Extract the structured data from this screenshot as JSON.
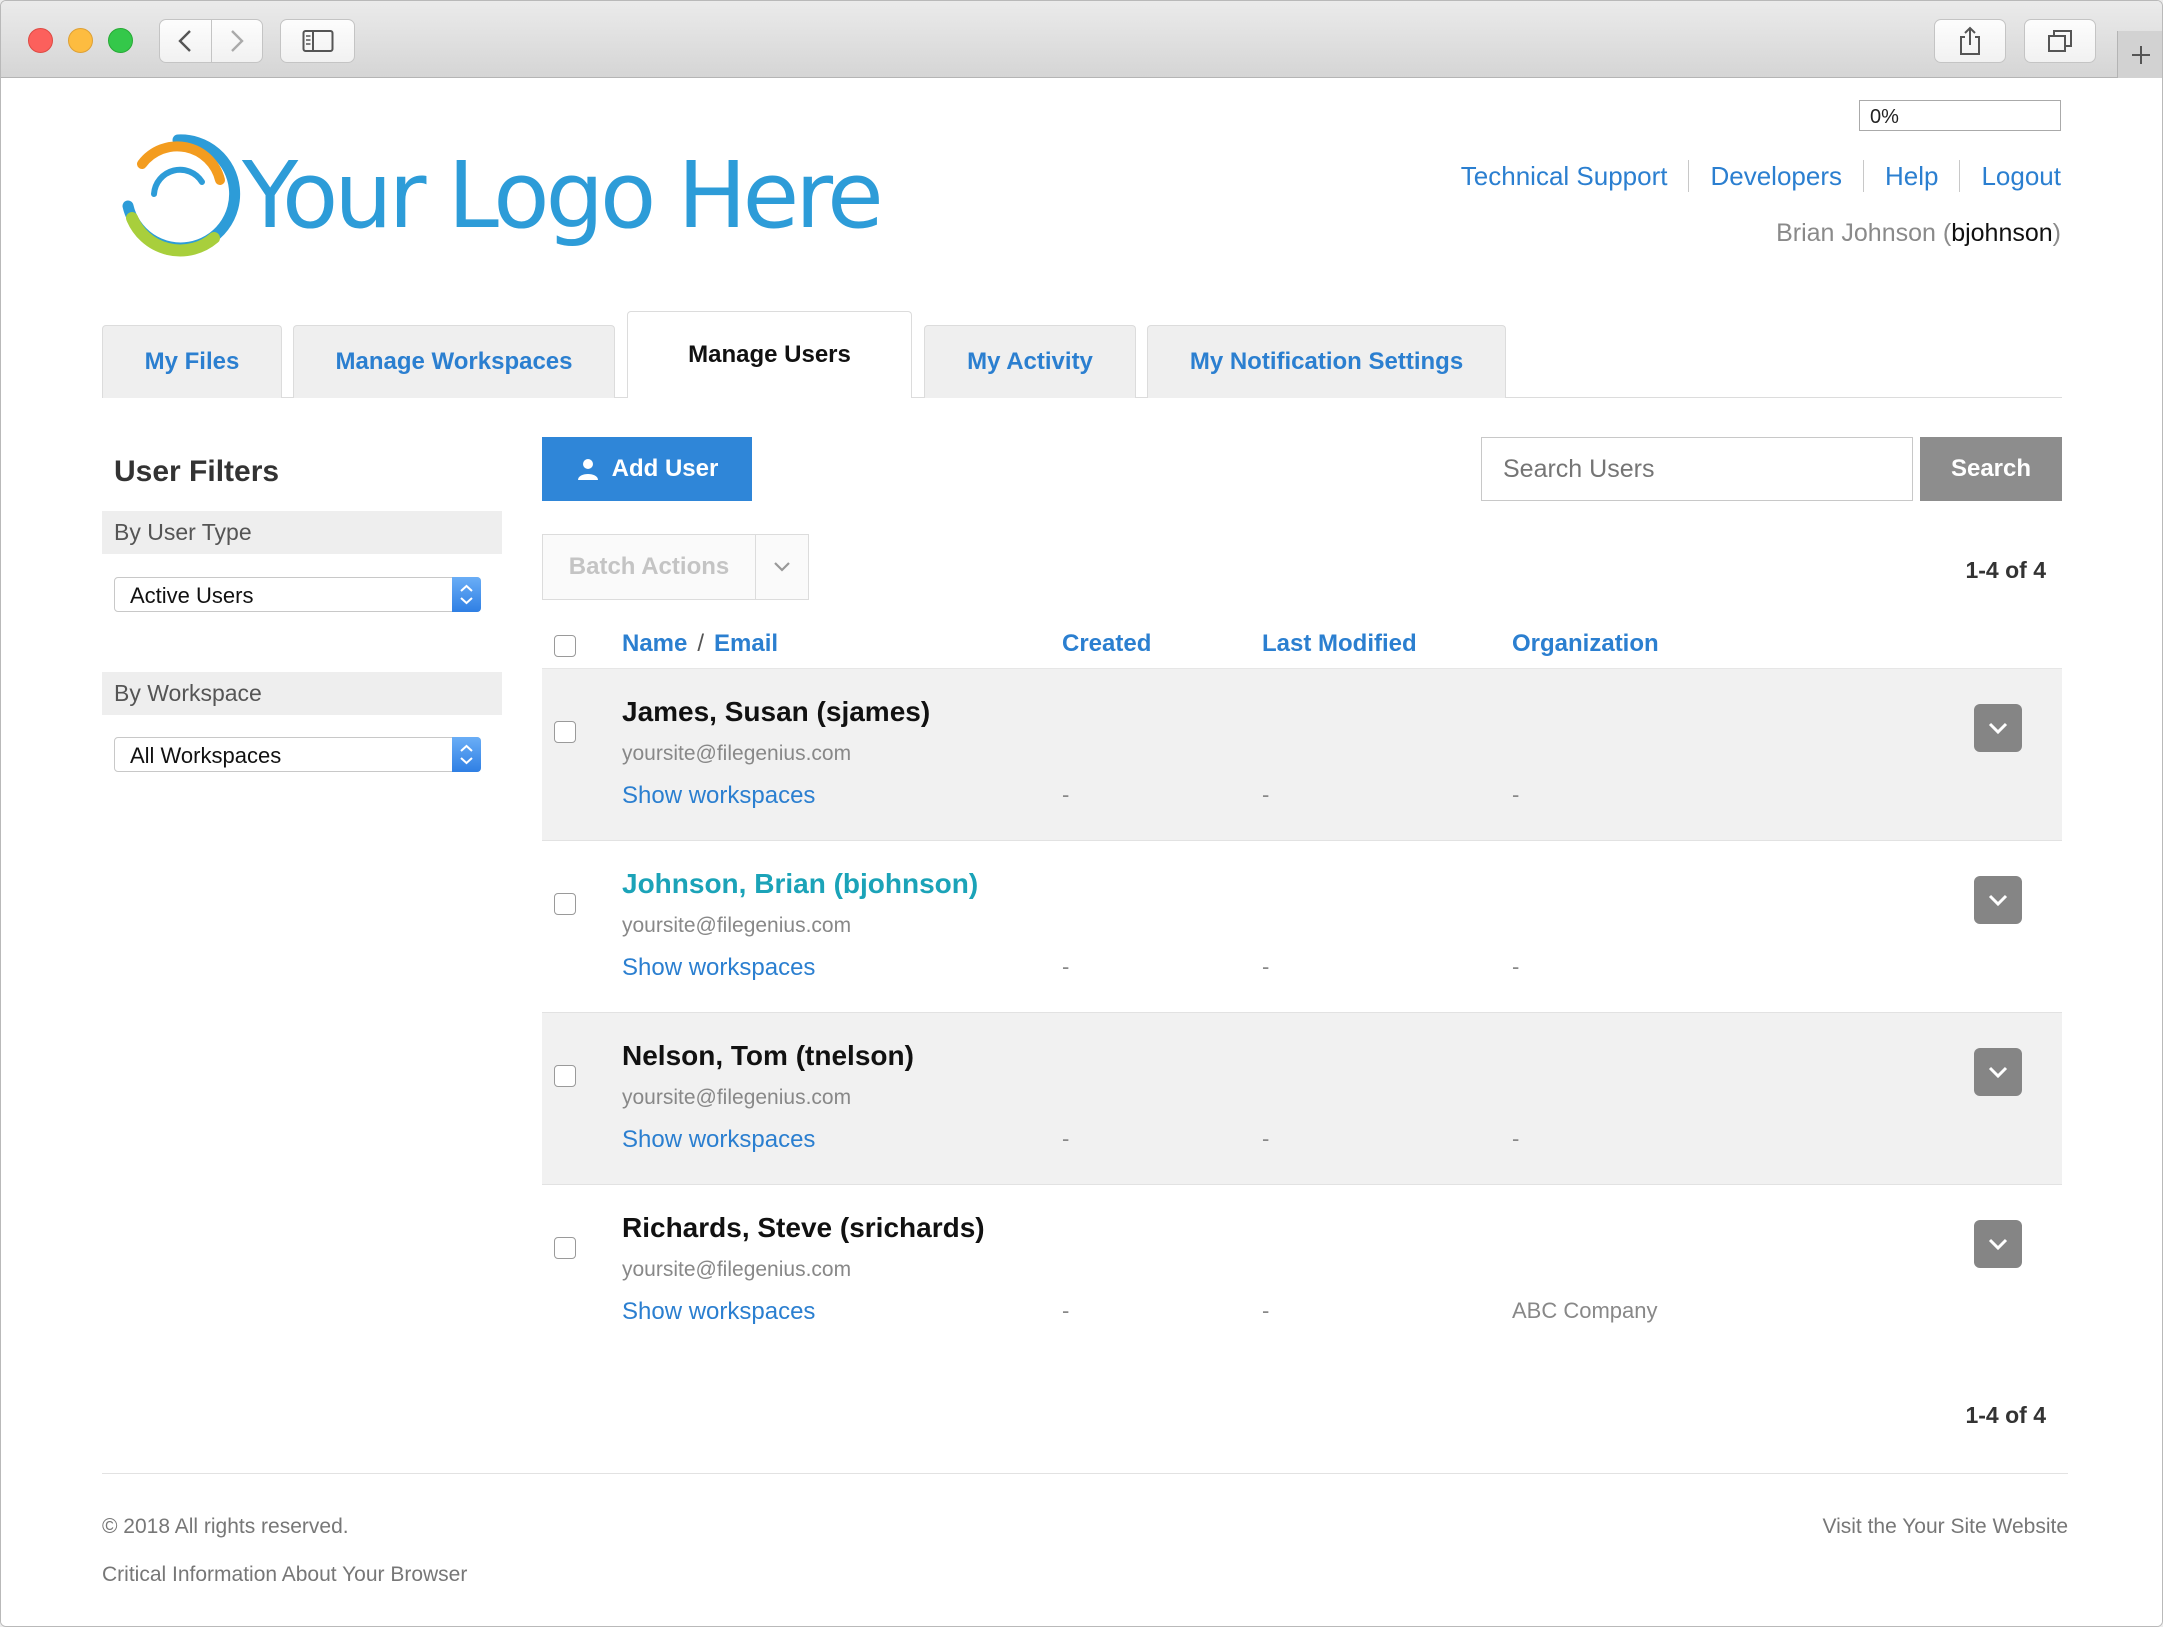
{
  "browser": {
    "back_icon": "chevron-left-icon",
    "forward_icon": "chevron-right-icon",
    "sidebar_icon": "sidebar-icon",
    "share_icon": "share-icon",
    "tabs_icon": "tabs-overview-icon",
    "new_tab_icon": "plus-icon"
  },
  "header": {
    "logo_text": "Your Logo Here",
    "progress_label": "0%",
    "progress_value": 0,
    "links": [
      "Technical Support",
      "Developers",
      "Help",
      "Logout"
    ],
    "user_display": "Brian Johnson",
    "user_login": "bjohnson"
  },
  "tabs": [
    {
      "label": "My Files",
      "active": false
    },
    {
      "label": "Manage Workspaces",
      "active": false
    },
    {
      "label": "Manage Users",
      "active": true
    },
    {
      "label": "My Activity",
      "active": false
    },
    {
      "label": "My Notification Settings",
      "active": false
    }
  ],
  "sidebar": {
    "title": "User Filters",
    "user_type_heading": "By User Type",
    "user_type_value": "Active Users",
    "workspace_heading": "By Workspace",
    "workspace_value": "All Workspaces"
  },
  "toolbar": {
    "add_user_label": "Add User",
    "search_placeholder": "Search Users",
    "search_label": "Search",
    "batch_label": "Batch Actions",
    "count_top": "1-4 of 4",
    "count_bottom": "1-4 of 4"
  },
  "table": {
    "columns": {
      "name": "Name",
      "email": "Email",
      "created": "Created",
      "modified": "Last Modified",
      "organization": "Organization"
    },
    "rows": [
      {
        "name": "James, Susan (sjames)",
        "email": "yoursite@filegenius.com",
        "show": "Show workspaces",
        "created": "-",
        "modified": "-",
        "organization": "-",
        "current_user": false
      },
      {
        "name": "Johnson, Brian (bjohnson)",
        "email": "yoursite@filegenius.com",
        "show": "Show workspaces",
        "created": "-",
        "modified": "-",
        "organization": "-",
        "current_user": true
      },
      {
        "name": "Nelson, Tom (tnelson)",
        "email": "yoursite@filegenius.com",
        "show": "Show workspaces",
        "created": "-",
        "modified": "-",
        "organization": "-",
        "current_user": false
      },
      {
        "name": "Richards, Steve (srichards)",
        "email": "yoursite@filegenius.com",
        "show": "Show workspaces",
        "created": "-",
        "modified": "-",
        "organization": "ABC Company",
        "current_user": false
      }
    ]
  },
  "footer": {
    "copyright": "© 2018 All rights reserved.",
    "browser_info": "Critical Information About Your Browser",
    "site_link": "Visit the Your Site Website"
  },
  "colors": {
    "accent": "#2b7fd0",
    "current_user": "#1ba3b8",
    "button_gray": "#8d8d8d",
    "row_alt": "#f1f1f1"
  }
}
